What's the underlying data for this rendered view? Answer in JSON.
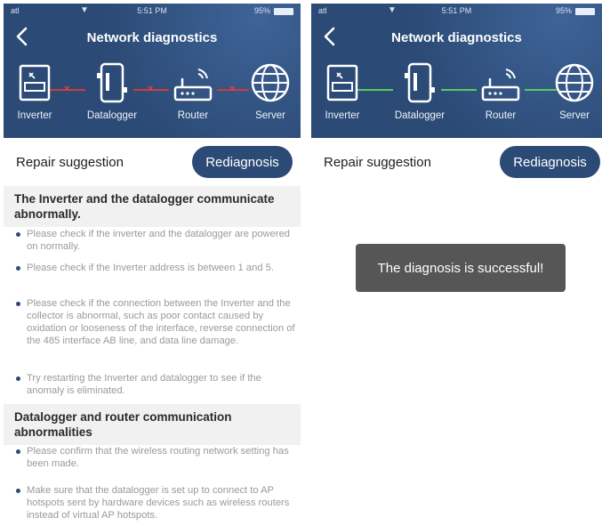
{
  "left": {
    "status": {
      "signal": "atl",
      "time": "5:51 PM",
      "battery": "95%"
    },
    "title": "Network diagnostics",
    "devices": [
      {
        "label": "Inverter",
        "icon": "inverter-icon"
      },
      {
        "label": "Datalogger",
        "icon": "datalogger-icon"
      },
      {
        "label": "Router",
        "icon": "router-icon"
      },
      {
        "label": "Server",
        "icon": "globe-icon"
      }
    ],
    "link_status": "failed",
    "repair_label": "Repair suggestion",
    "rediagnosis_label": "Rediagnosis",
    "sections": [
      {
        "heading": "The Inverter and the datalogger communicate abnormally.",
        "bullets": [
          "Please check if the inverter and the datalogger are powered on normally.",
          "Please check if the Inverter address is between 1 and 5.",
          "Please check if the connection between the Inverter and the collector is abnormal, such as poor contact caused by oxidation or looseness of the interface, reverse connection of the 485 interface AB line, and data line damage.",
          "Try restarting the Inverter and datalogger to see if the anomaly is eliminated."
        ]
      },
      {
        "heading": "Datalogger and router communication abnormalities",
        "bullets": [
          "Please confirm that the wireless routing network setting has been made.",
          "Make sure that the datalogger is set up to connect to AP hotspots sent by hardware devices such as wireless routers instead of virtual AP hotspots."
        ]
      }
    ]
  },
  "right": {
    "status": {
      "signal": "atl",
      "time": "5:51 PM",
      "battery": "95%"
    },
    "title": "Network diagnostics",
    "devices": [
      {
        "label": "Inverter",
        "icon": "inverter-icon"
      },
      {
        "label": "Datalogger",
        "icon": "datalogger-icon"
      },
      {
        "label": "Router",
        "icon": "router-icon"
      },
      {
        "label": "Server",
        "icon": "globe-icon"
      }
    ],
    "link_status": "ok",
    "repair_label": "Repair suggestion",
    "rediagnosis_label": "Rediagnosis",
    "toast": "The diagnosis is successful!"
  },
  "colors": {
    "header": "#2b4a75",
    "link_fail": "#d33a3a",
    "link_ok": "#5cc95c",
    "bullet_dot": "#2b4a75",
    "toast_bg": "#565656"
  }
}
